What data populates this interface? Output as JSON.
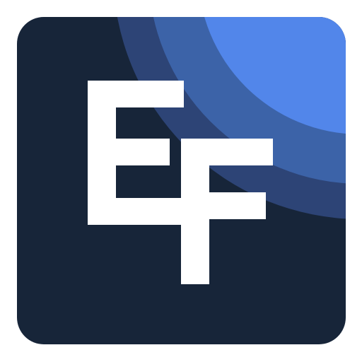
{
  "icon": {
    "name": "EF app icon",
    "logo_text": "EF",
    "colors": {
      "background": "#172539",
      "arc_outer": "#2d4476",
      "arc_middle": "#3c63a8",
      "arc_inner": "#5286ea",
      "letters": "#ffffff"
    }
  }
}
